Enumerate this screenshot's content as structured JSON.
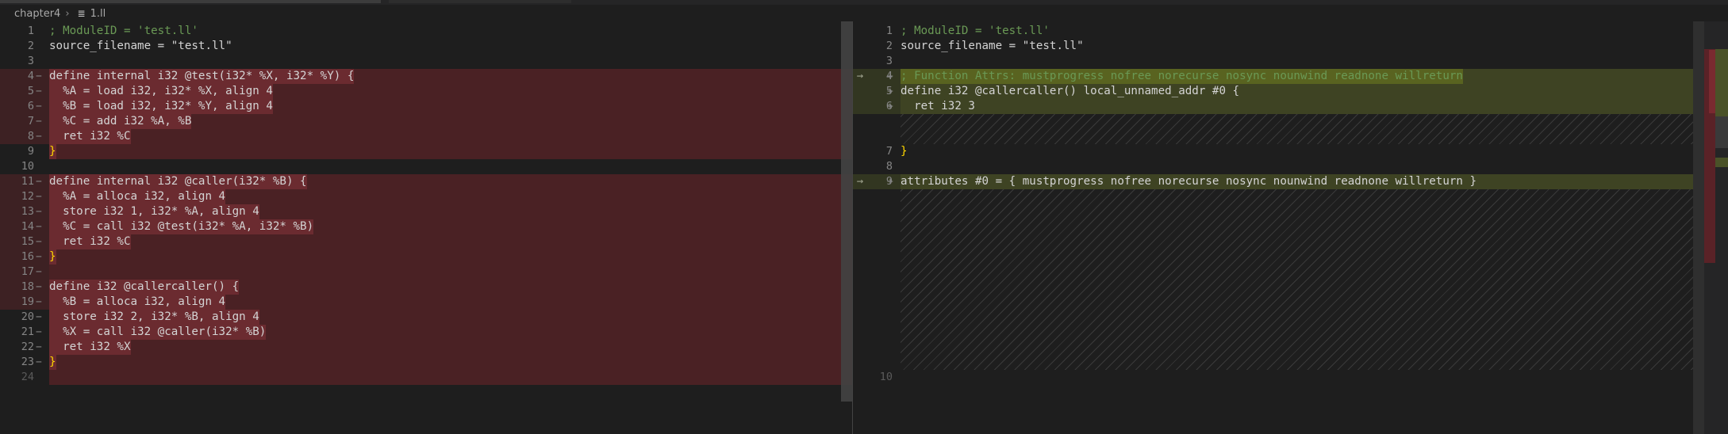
{
  "breadcrumb": {
    "folder": "chapter4",
    "file": "1.ll"
  },
  "colors": {
    "background": "#1e1e1e",
    "deleted_line_bg": "#4a2124",
    "inserted_line_bg": "#3e4323",
    "keyword": "#569cd6",
    "string": "#ce9178",
    "comment": "#6a9955"
  },
  "left": {
    "lines": [
      {
        "num": "1",
        "sign": "",
        "text": "; ModuleID = 'test.ll'"
      },
      {
        "num": "2",
        "sign": "",
        "text": "source_filename = \"test.ll\""
      },
      {
        "num": "3",
        "sign": "",
        "text": ""
      },
      {
        "num": "4",
        "sign": "−",
        "text": "define internal i32 @test(i32* %X, i32* %Y) {"
      },
      {
        "num": "5",
        "sign": "−",
        "text": "  %A = load i32, i32* %X, align 4"
      },
      {
        "num": "6",
        "sign": "−",
        "text": "  %B = load i32, i32* %Y, align 4"
      },
      {
        "num": "7",
        "sign": "−",
        "text": "  %C = add i32 %A, %B"
      },
      {
        "num": "8",
        "sign": "−",
        "text": "  ret i32 %C"
      },
      {
        "num": "9",
        "sign": "",
        "text": "}"
      },
      {
        "num": "10",
        "sign": "",
        "text": ""
      },
      {
        "num": "11",
        "sign": "−",
        "text": "define internal i32 @caller(i32* %B) {"
      },
      {
        "num": "12",
        "sign": "−",
        "text": "  %A = alloca i32, align 4"
      },
      {
        "num": "13",
        "sign": "−",
        "text": "  store i32 1, i32* %A, align 4"
      },
      {
        "num": "14",
        "sign": "−",
        "text": "  %C = call i32 @test(i32* %A, i32* %B)"
      },
      {
        "num": "15",
        "sign": "−",
        "text": "  ret i32 %C"
      },
      {
        "num": "16",
        "sign": "−",
        "text": "}"
      },
      {
        "num": "17",
        "sign": "−",
        "text": ""
      },
      {
        "num": "18",
        "sign": "−",
        "text": "define i32 @callercaller() {"
      },
      {
        "num": "19",
        "sign": "−",
        "text": "  %B = alloca i32, align 4"
      },
      {
        "num": "20",
        "sign": "−",
        "text": "  store i32 2, i32* %B, align 4"
      },
      {
        "num": "21",
        "sign": "−",
        "text": "  %X = call i32 @caller(i32* %B)"
      },
      {
        "num": "22",
        "sign": "−",
        "text": "  ret i32 %X"
      },
      {
        "num": "23",
        "sign": "−",
        "text": "}"
      },
      {
        "num": "24",
        "sign": "",
        "text": ""
      }
    ]
  },
  "right": {
    "lines": [
      {
        "num": "1",
        "sign": "",
        "text": "; ModuleID = 'test.ll'"
      },
      {
        "num": "2",
        "sign": "",
        "text": "source_filename = \"test.ll\""
      },
      {
        "num": "3",
        "sign": "",
        "text": ""
      },
      {
        "num": "4",
        "sign": "+",
        "text": "; Function Attrs: mustprogress nofree norecurse nosync nounwind readnone willreturn"
      },
      {
        "num": "5",
        "sign": "+",
        "text": "define i32 @callercaller() local_unnamed_addr #0 {"
      },
      {
        "num": "6",
        "sign": "+",
        "text": "  ret i32 3"
      },
      {
        "num": "7",
        "sign": "",
        "text": "}"
      },
      {
        "num": "8",
        "sign": "",
        "text": ""
      },
      {
        "num": "9",
        "sign": "+",
        "text": "attributes #0 = { mustprogress nofree norecurse nosync nounwind readnone willreturn }"
      },
      {
        "num": "10",
        "sign": "",
        "text": ""
      }
    ]
  }
}
